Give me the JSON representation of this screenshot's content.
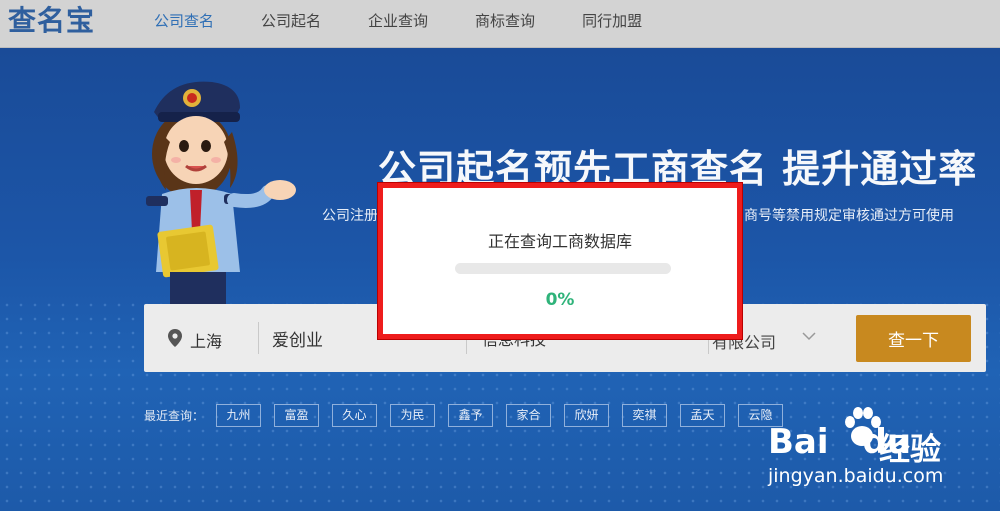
{
  "header": {
    "logo": "查名宝",
    "nav": [
      {
        "label": "公司查名",
        "active": true
      },
      {
        "label": "公司起名",
        "active": false
      },
      {
        "label": "企业查询",
        "active": false
      },
      {
        "label": "商标查询",
        "active": false
      },
      {
        "label": "同行加盟",
        "active": false
      }
    ]
  },
  "hero": {
    "headline": "公司起名预先工商查名  提升通过率",
    "subtitle_left": "公司注册",
    "subtitle_right": "商号等禁用规定审核通过方可使用"
  },
  "search": {
    "location": "上海",
    "company_name_value": "爱创业",
    "industry_value": "信息科技",
    "company_type": "有限公司",
    "button_label": "查一下"
  },
  "recent": {
    "label": "最近查询：",
    "tags": [
      "九州",
      "富盈",
      "久心",
      "为民",
      "鑫予",
      "家合",
      "欣妍",
      "奕祺",
      "孟天",
      "云隐"
    ]
  },
  "modal": {
    "title": "正在查询工商数据库",
    "progress_percent": 0,
    "progress_label": "0%"
  },
  "watermark": {
    "brand_latin": "Bai",
    "brand_latin_2": "du",
    "brand_cn": "经验",
    "url": "jingyan.baidu.com"
  },
  "colors": {
    "accent": "#2f6fb5",
    "button": "#c8891f",
    "progress": "#2fb37a",
    "modal_border": "#ee1c1c",
    "hero_bg": "#1b4c9a"
  },
  "icons": {
    "location": "map-pin-icon",
    "dropdown": "chevron-down-icon",
    "watermark_paw": "paw-icon"
  }
}
